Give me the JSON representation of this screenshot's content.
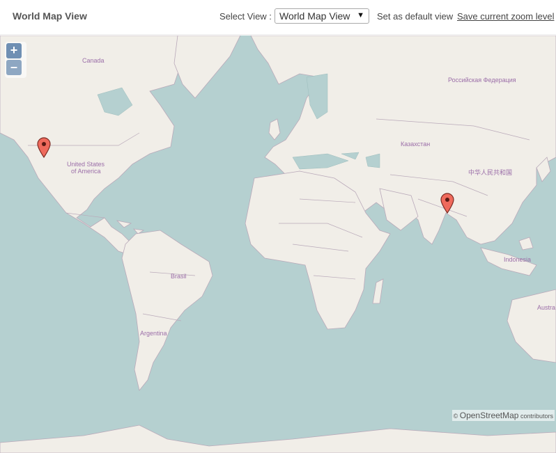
{
  "header": {
    "title": "World Map View",
    "select_label": "Select View :",
    "select_value": "World Map View",
    "set_default_label": "Set as default view",
    "save_zoom_label": "Save current zoom level"
  },
  "map": {
    "zoom_in": "+",
    "zoom_out": "–",
    "labels": {
      "canada": "Canada",
      "usa_line1": "United States",
      "usa_line2": "of America",
      "russia": "Российская Федерация",
      "kazakhstan": "Казахстан",
      "china": "中华人民共和国",
      "brazil": "Brasil",
      "argentina": "Argentina",
      "indonesia": "Indonesia",
      "australia": "Austra"
    },
    "attribution_symbol": "©",
    "attribution_brand": "OpenStreetMap",
    "attribution_suffix": " contributors",
    "colors": {
      "water": "#b5d0d0",
      "land": "#f1eee8",
      "border": "#b9a9b9",
      "marker": "#ef6a5c"
    }
  }
}
